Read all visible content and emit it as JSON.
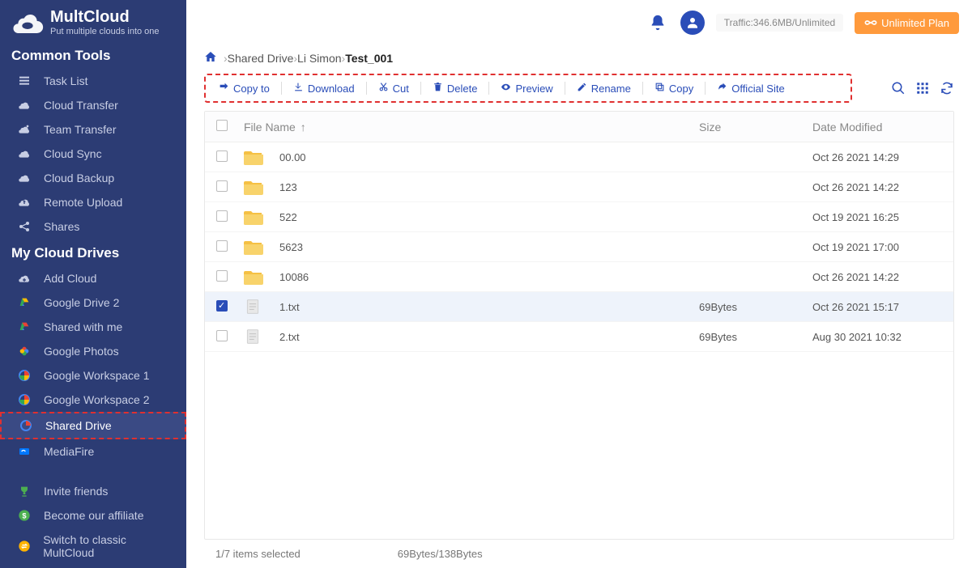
{
  "brand": {
    "title": "MultCloud",
    "subtitle": "Put multiple clouds into one"
  },
  "sidebar": {
    "common_tools_header": "Common Tools",
    "common_tools": [
      {
        "label": "Task List",
        "icon": "list"
      },
      {
        "label": "Cloud Transfer",
        "icon": "cloud"
      },
      {
        "label": "Team Transfer",
        "icon": "team"
      },
      {
        "label": "Cloud Sync",
        "icon": "sync"
      },
      {
        "label": "Cloud Backup",
        "icon": "backup"
      },
      {
        "label": "Remote Upload",
        "icon": "upload"
      },
      {
        "label": "Shares",
        "icon": "share"
      }
    ],
    "my_drives_header": "My Cloud Drives",
    "drives": [
      {
        "label": "Add Cloud",
        "icon": "add"
      },
      {
        "label": "Google Drive 2",
        "icon": "gdrive"
      },
      {
        "label": "Shared with me",
        "icon": "shared"
      },
      {
        "label": "Google Photos",
        "icon": "gphotos"
      },
      {
        "label": "Google Workspace 1",
        "icon": "gwork"
      },
      {
        "label": "Google Workspace 2",
        "icon": "gwork"
      },
      {
        "label": "Shared Drive",
        "icon": "gshared",
        "active": true,
        "highlighted": true
      },
      {
        "label": "MediaFire",
        "icon": "mediafire"
      }
    ],
    "bottom": [
      {
        "label": "Invite friends",
        "icon": "trophy"
      },
      {
        "label": "Become our affiliate",
        "icon": "dollar"
      },
      {
        "label": "Switch to classic MultCloud",
        "icon": "switch"
      }
    ]
  },
  "topbar": {
    "traffic": "Traffic:346.6MB/Unlimited",
    "plan_button": "Unlimited Plan"
  },
  "breadcrumb": [
    {
      "label": "Shared Drive"
    },
    {
      "label": "Li Simon"
    },
    {
      "label": "Test_001",
      "current": true
    }
  ],
  "toolbar": [
    {
      "label": "Copy to",
      "icon": "copyto"
    },
    {
      "label": "Download",
      "icon": "download"
    },
    {
      "label": "Cut",
      "icon": "cut"
    },
    {
      "label": "Delete",
      "icon": "delete"
    },
    {
      "label": "Preview",
      "icon": "preview"
    },
    {
      "label": "Rename",
      "icon": "rename"
    },
    {
      "label": "Copy",
      "icon": "copy"
    },
    {
      "label": "Official Site",
      "icon": "site"
    }
  ],
  "columns": {
    "name": "File Name",
    "size": "Size",
    "date": "Date Modified"
  },
  "files": [
    {
      "name": "00.00",
      "type": "folder",
      "size": "",
      "date": "Oct 26 2021 14:29",
      "checked": false
    },
    {
      "name": "123",
      "type": "folder",
      "size": "",
      "date": "Oct 26 2021 14:22",
      "checked": false
    },
    {
      "name": "522",
      "type": "folder",
      "size": "",
      "date": "Oct 19 2021 16:25",
      "checked": false
    },
    {
      "name": "5623",
      "type": "folder",
      "size": "",
      "date": "Oct 19 2021 17:00",
      "checked": false
    },
    {
      "name": "10086",
      "type": "folder",
      "size": "",
      "date": "Oct 26 2021 14:22",
      "checked": false
    },
    {
      "name": "1.txt",
      "type": "file",
      "size": "69Bytes",
      "date": "Oct 26 2021 15:17",
      "checked": true
    },
    {
      "name": "2.txt",
      "type": "file",
      "size": "69Bytes",
      "date": "Aug 30 2021 10:32",
      "checked": false
    }
  ],
  "status": {
    "selection": "1/7 items selected",
    "size": "69Bytes/138Bytes"
  }
}
